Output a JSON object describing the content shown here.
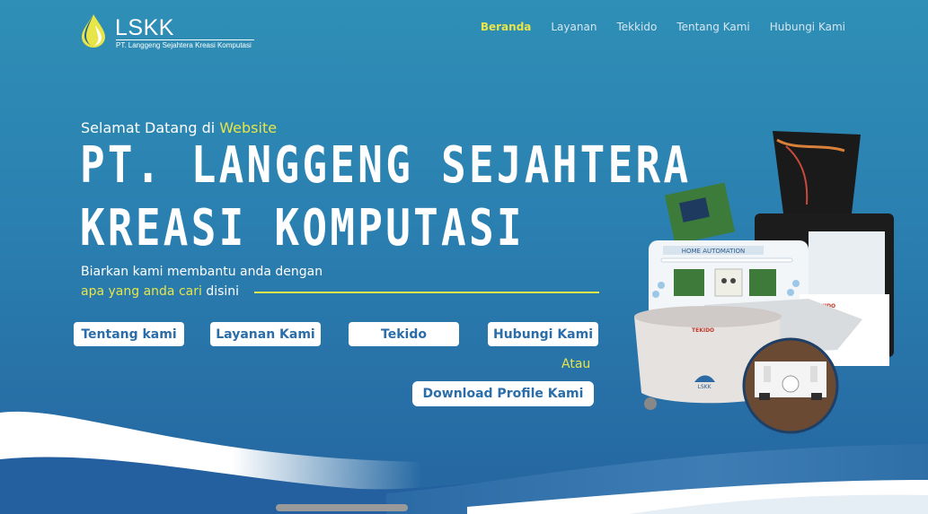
{
  "header": {
    "logo_title": "LSKK",
    "logo_subtitle": "PT. Langgeng Sejahtera Kreasi Komputasi",
    "nav": [
      {
        "label": "Beranda",
        "active": true
      },
      {
        "label": "Layanan",
        "active": false
      },
      {
        "label": "Tekkido",
        "active": false
      },
      {
        "label": "Tentang Kami",
        "active": false
      },
      {
        "label": "Hubungi Kami",
        "active": false
      }
    ]
  },
  "hero": {
    "welcome_prefix": "Selamat Datang di",
    "welcome_highlight": "Website",
    "title_line1": "PT. LANGGENG SEJAHTERA",
    "title_line2": "KREASI KOMPUTASI",
    "desc_line1": "Biarkan kami membantu anda dengan",
    "desc_highlight": "apa yang anda cari",
    "desc_rest": "disini",
    "buttons": [
      "Tentang kami",
      "Layanan Kami",
      "Tekido",
      "Hubungi Kami"
    ],
    "or_text": "Atau",
    "download_label": "Download Profile Kami"
  },
  "product_labels": {
    "panel_label": "HOME AUTOMATION",
    "brand_1": "TEKIDO",
    "brand_2": "LSKK"
  },
  "colors": {
    "accent_yellow": "#e7e548",
    "button_text": "#2a6da8",
    "background_top": "#2f8fb6",
    "background_bottom": "#2565a0"
  }
}
